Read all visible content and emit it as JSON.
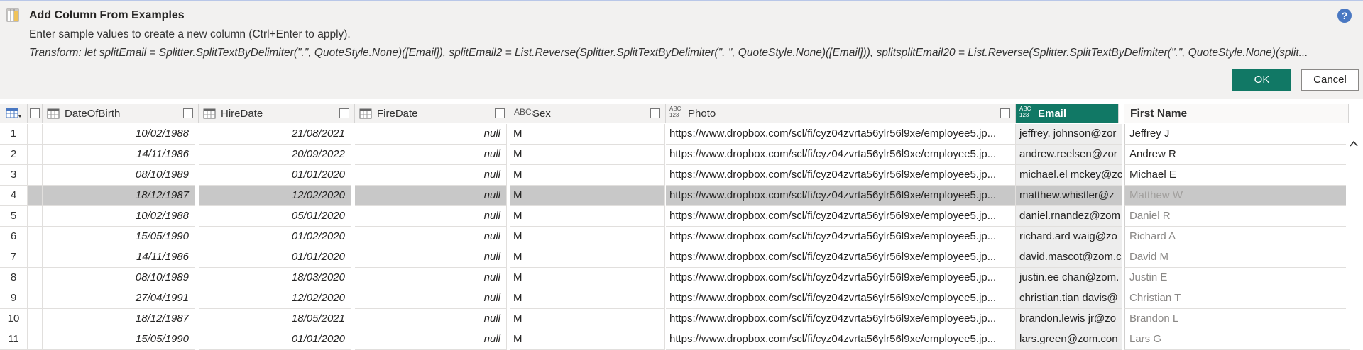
{
  "dialog": {
    "title": "Add Column From Examples",
    "subtitle": "Enter sample values to create a new column (Ctrl+Enter to apply).",
    "transform": "Transform: let splitEmail = Splitter.SplitTextByDelimiter(\".\", QuoteStyle.None)([Email]), splitEmail2 = List.Reverse(Splitter.SplitTextByDelimiter(\". \", QuoteStyle.None)([Email])), splitsplitEmail20 = List.Reverse(Splitter.SplitTextByDelimiter(\".\", QuoteStyle.None)(split...",
    "help": "?",
    "ok_label": "OK",
    "cancel_label": "Cancel"
  },
  "columns": {
    "dob": {
      "name": "DateOfBirth",
      "type": "date"
    },
    "hire": {
      "name": "HireDate",
      "type": "date"
    },
    "fire": {
      "name": "FireDate",
      "type": "date"
    },
    "sex": {
      "name": "Sex",
      "type": "ABC",
      "type_sub": "C"
    },
    "photo": {
      "name": "Photo",
      "type": "ABC 123"
    },
    "email": {
      "name": "Email",
      "type": "ABC 123"
    },
    "first": {
      "name": "First Name"
    }
  },
  "rows": [
    {
      "num": "1",
      "dob": "10/02/1988",
      "hire": "21/08/2021",
      "fire": "null",
      "sex": "M",
      "photo": "https://www.dropbox.com/scl/fi/cyz04zvrta56ylr56l9xe/employee5.jp...",
      "email": "jeffrey. johnson@zor",
      "first": "Jeffrey J",
      "first_state": "entered"
    },
    {
      "num": "2",
      "dob": "14/11/1986",
      "hire": "20/09/2022",
      "fire": "null",
      "sex": "M",
      "photo": "https://www.dropbox.com/scl/fi/cyz04zvrta56ylr56l9xe/employee5.jp...",
      "email": "andrew.reelsen@zor",
      "first": "Andrew R",
      "first_state": "entered"
    },
    {
      "num": "3",
      "dob": "08/10/1989",
      "hire": "01/01/2020",
      "fire": "null",
      "sex": "M",
      "photo": "https://www.dropbox.com/scl/fi/cyz04zvrta56ylr56l9xe/employee5.jp...",
      "email": "michael.el mckey@zc",
      "first": "Michael E",
      "first_state": "entered"
    },
    {
      "num": "4",
      "dob": "18/12/1987",
      "hire": "12/02/2020",
      "fire": "null",
      "sex": "M",
      "photo": "https://www.dropbox.com/scl/fi/cyz04zvrta56ylr56l9xe/employee5.jp...",
      "email": "matthew.whistler@z",
      "first": "Matthew W",
      "first_state": "suggested"
    },
    {
      "num": "5",
      "dob": "10/02/1988",
      "hire": "05/01/2020",
      "fire": "null",
      "sex": "M",
      "photo": "https://www.dropbox.com/scl/fi/cyz04zvrta56ylr56l9xe/employee5.jp...",
      "email": "daniel.rnandez@zom",
      "first": "Daniel R",
      "first_state": "suggested"
    },
    {
      "num": "6",
      "dob": "15/05/1990",
      "hire": "01/02/2020",
      "fire": "null",
      "sex": "M",
      "photo": "https://www.dropbox.com/scl/fi/cyz04zvrta56ylr56l9xe/employee5.jp...",
      "email": "richard.ard waig@zo",
      "first": "Richard A",
      "first_state": "suggested"
    },
    {
      "num": "7",
      "dob": "14/11/1986",
      "hire": "01/01/2020",
      "fire": "null",
      "sex": "M",
      "photo": "https://www.dropbox.com/scl/fi/cyz04zvrta56ylr56l9xe/employee5.jp...",
      "email": "david.mascot@zom.c",
      "first": "David M",
      "first_state": "suggested"
    },
    {
      "num": "8",
      "dob": "08/10/1989",
      "hire": "18/03/2020",
      "fire": "null",
      "sex": "M",
      "photo": "https://www.dropbox.com/scl/fi/cyz04zvrta56ylr56l9xe/employee5.jp...",
      "email": "justin.ee chan@zom.",
      "first": "Justin E",
      "first_state": "suggested"
    },
    {
      "num": "9",
      "dob": "27/04/1991",
      "hire": "12/02/2020",
      "fire": "null",
      "sex": "M",
      "photo": "https://www.dropbox.com/scl/fi/cyz04zvrta56ylr56l9xe/employee5.jp...",
      "email": "christian.tian davis@",
      "first": "Christian T",
      "first_state": "suggested"
    },
    {
      "num": "10",
      "dob": "18/12/1987",
      "hire": "18/05/2021",
      "fire": "null",
      "sex": "M",
      "photo": "https://www.dropbox.com/scl/fi/cyz04zvrta56ylr56l9xe/employee5.jp...",
      "email": "brandon.lewis jr@zo",
      "first": "Brandon L",
      "first_state": "suggested"
    },
    {
      "num": "11",
      "dob": "15/05/1990",
      "hire": "01/01/2020",
      "fire": "null",
      "sex": "M",
      "photo": "https://www.dropbox.com/scl/fi/cyz04zvrta56ylr56l9xe/employee5.jp...",
      "email": "lars.green@zom.con",
      "first": "Lars G",
      "first_state": "suggested"
    }
  ],
  "selected_row": "4",
  "colors": {
    "accent": "#117865",
    "header_bg": "#f2f1f0",
    "selected_row": "#c8c8c8"
  }
}
